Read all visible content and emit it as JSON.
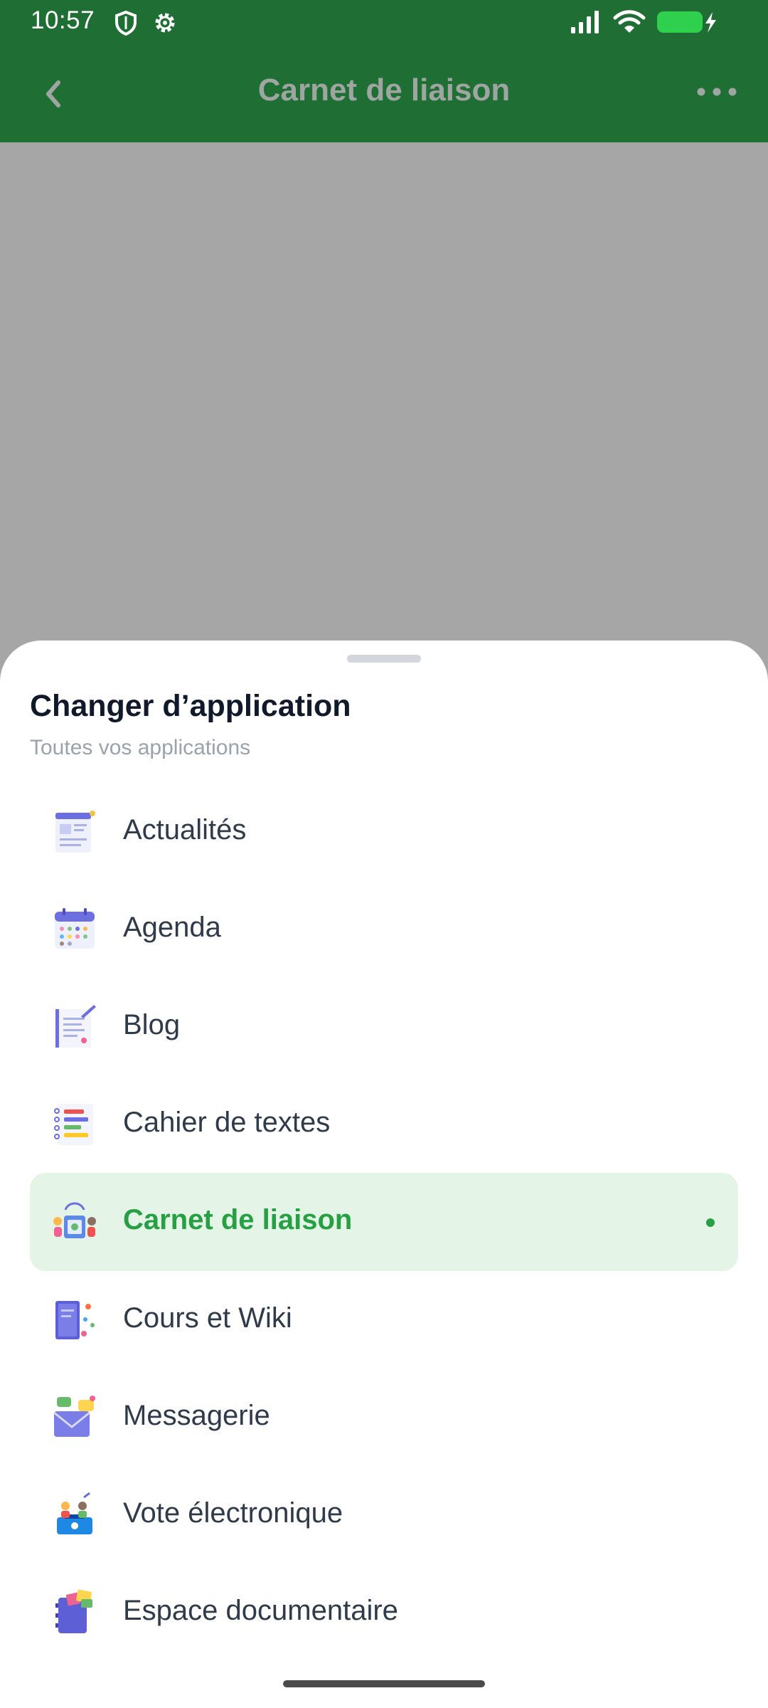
{
  "status_bar": {
    "time": "10:57"
  },
  "app_bar": {
    "title": "Carnet de liaison"
  },
  "sheet": {
    "title": "Changer d’application",
    "subtitle": "Toutes vos applications",
    "items": [
      {
        "label": "Actualités",
        "icon": "news-icon",
        "active": false
      },
      {
        "label": "Agenda",
        "icon": "calendar-icon",
        "active": false
      },
      {
        "label": "Blog",
        "icon": "blog-icon",
        "active": false
      },
      {
        "label": "Cahier de textes",
        "icon": "homework-book-icon",
        "active": false
      },
      {
        "label": "Carnet de liaison",
        "icon": "liaison-notebook-icon",
        "active": true
      },
      {
        "label": "Cours et Wiki",
        "icon": "courses-wiki-icon",
        "active": false
      },
      {
        "label": "Messagerie",
        "icon": "mail-icon",
        "active": false
      },
      {
        "label": "Vote électronique",
        "icon": "vote-icon",
        "active": false
      },
      {
        "label": "Espace documentaire",
        "icon": "documents-icon",
        "active": false
      }
    ]
  },
  "colors": {
    "header_green": "#1f6e34",
    "accent_green": "#27a043",
    "active_bg": "#e4f4e7",
    "scrim_gray": "#a6a6a6"
  }
}
